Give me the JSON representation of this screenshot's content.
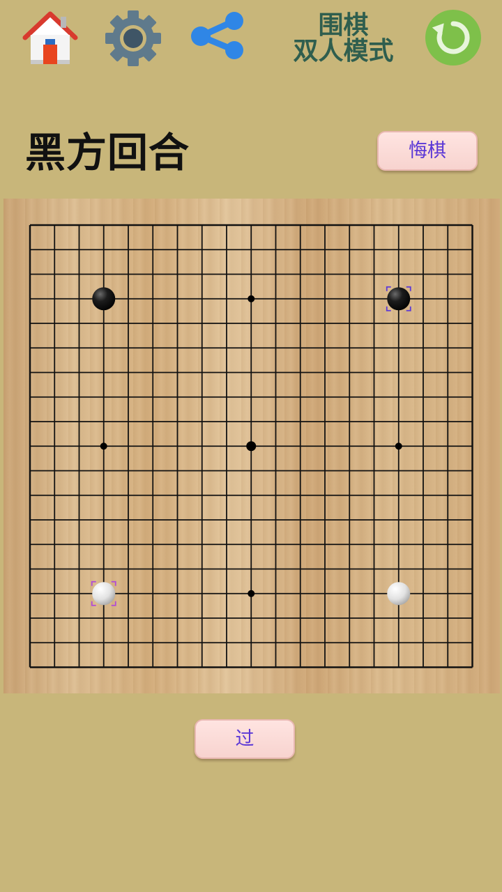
{
  "header": {
    "home_icon": "home-icon",
    "settings_icon": "gear-icon",
    "share_icon": "share-icon",
    "restart_icon": "restart-icon",
    "title_line1": "围棋",
    "title_line2": "双人模式",
    "title_color": "#2f5e4e"
  },
  "status": {
    "turn_label": "黑方回合"
  },
  "buttons": {
    "undo_label": "悔棋",
    "pass_label": "过"
  },
  "board": {
    "size": 19,
    "star_points": [
      [
        3,
        3
      ],
      [
        9,
        3
      ],
      [
        15,
        3
      ],
      [
        3,
        9
      ],
      [
        9,
        9
      ],
      [
        15,
        9
      ],
      [
        3,
        15
      ],
      [
        9,
        15
      ],
      [
        15,
        15
      ]
    ],
    "stones": [
      {
        "color": "black",
        "col": 3,
        "row": 3
      },
      {
        "color": "black",
        "col": 15,
        "row": 3,
        "last_marker": true
      },
      {
        "color": "white",
        "col": 3,
        "row": 15,
        "last_marker": true
      },
      {
        "color": "white",
        "col": 15,
        "row": 15
      }
    ]
  },
  "colors": {
    "background": "#c8b67a",
    "button_text": "#5b38d6",
    "restart": "#7ec04a"
  }
}
